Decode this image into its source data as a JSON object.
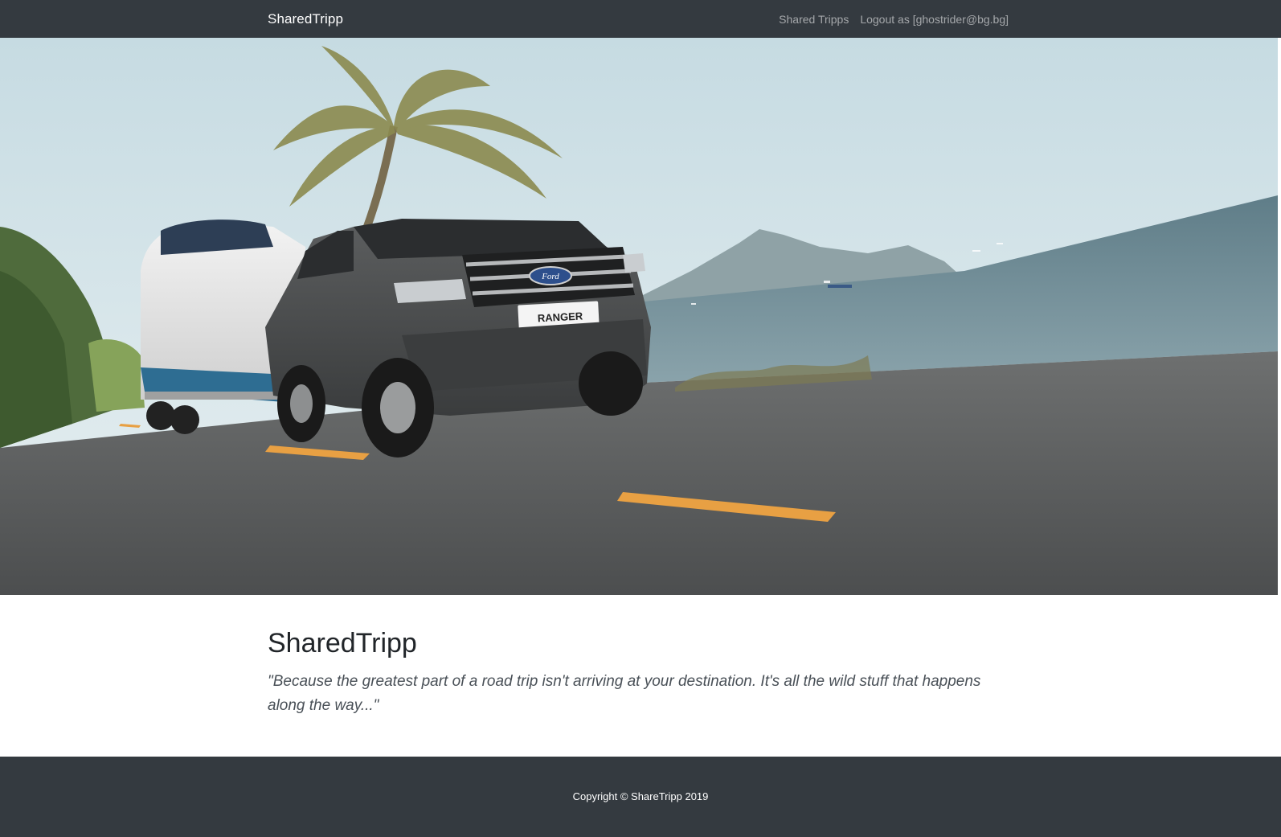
{
  "navbar": {
    "brand": "SharedTripp",
    "links": [
      {
        "label": "Shared Tripps"
      },
      {
        "label": "Logout as [ghostrider@bg.bg]"
      }
    ]
  },
  "hero": {
    "truck_badge": "RANGER",
    "truck_brand": "Ford"
  },
  "main": {
    "title": "SharedTripp",
    "quote": "\"Because the greatest part of a road trip isn't arriving at your destination. It's all the wild stuff that happens along the way...\""
  },
  "footer": {
    "copyright": "Copyright © ShareTripp 2019"
  },
  "colors": {
    "navbar_bg": "#343a40",
    "footer_bg": "#343a40",
    "road_line": "#e8a043"
  }
}
